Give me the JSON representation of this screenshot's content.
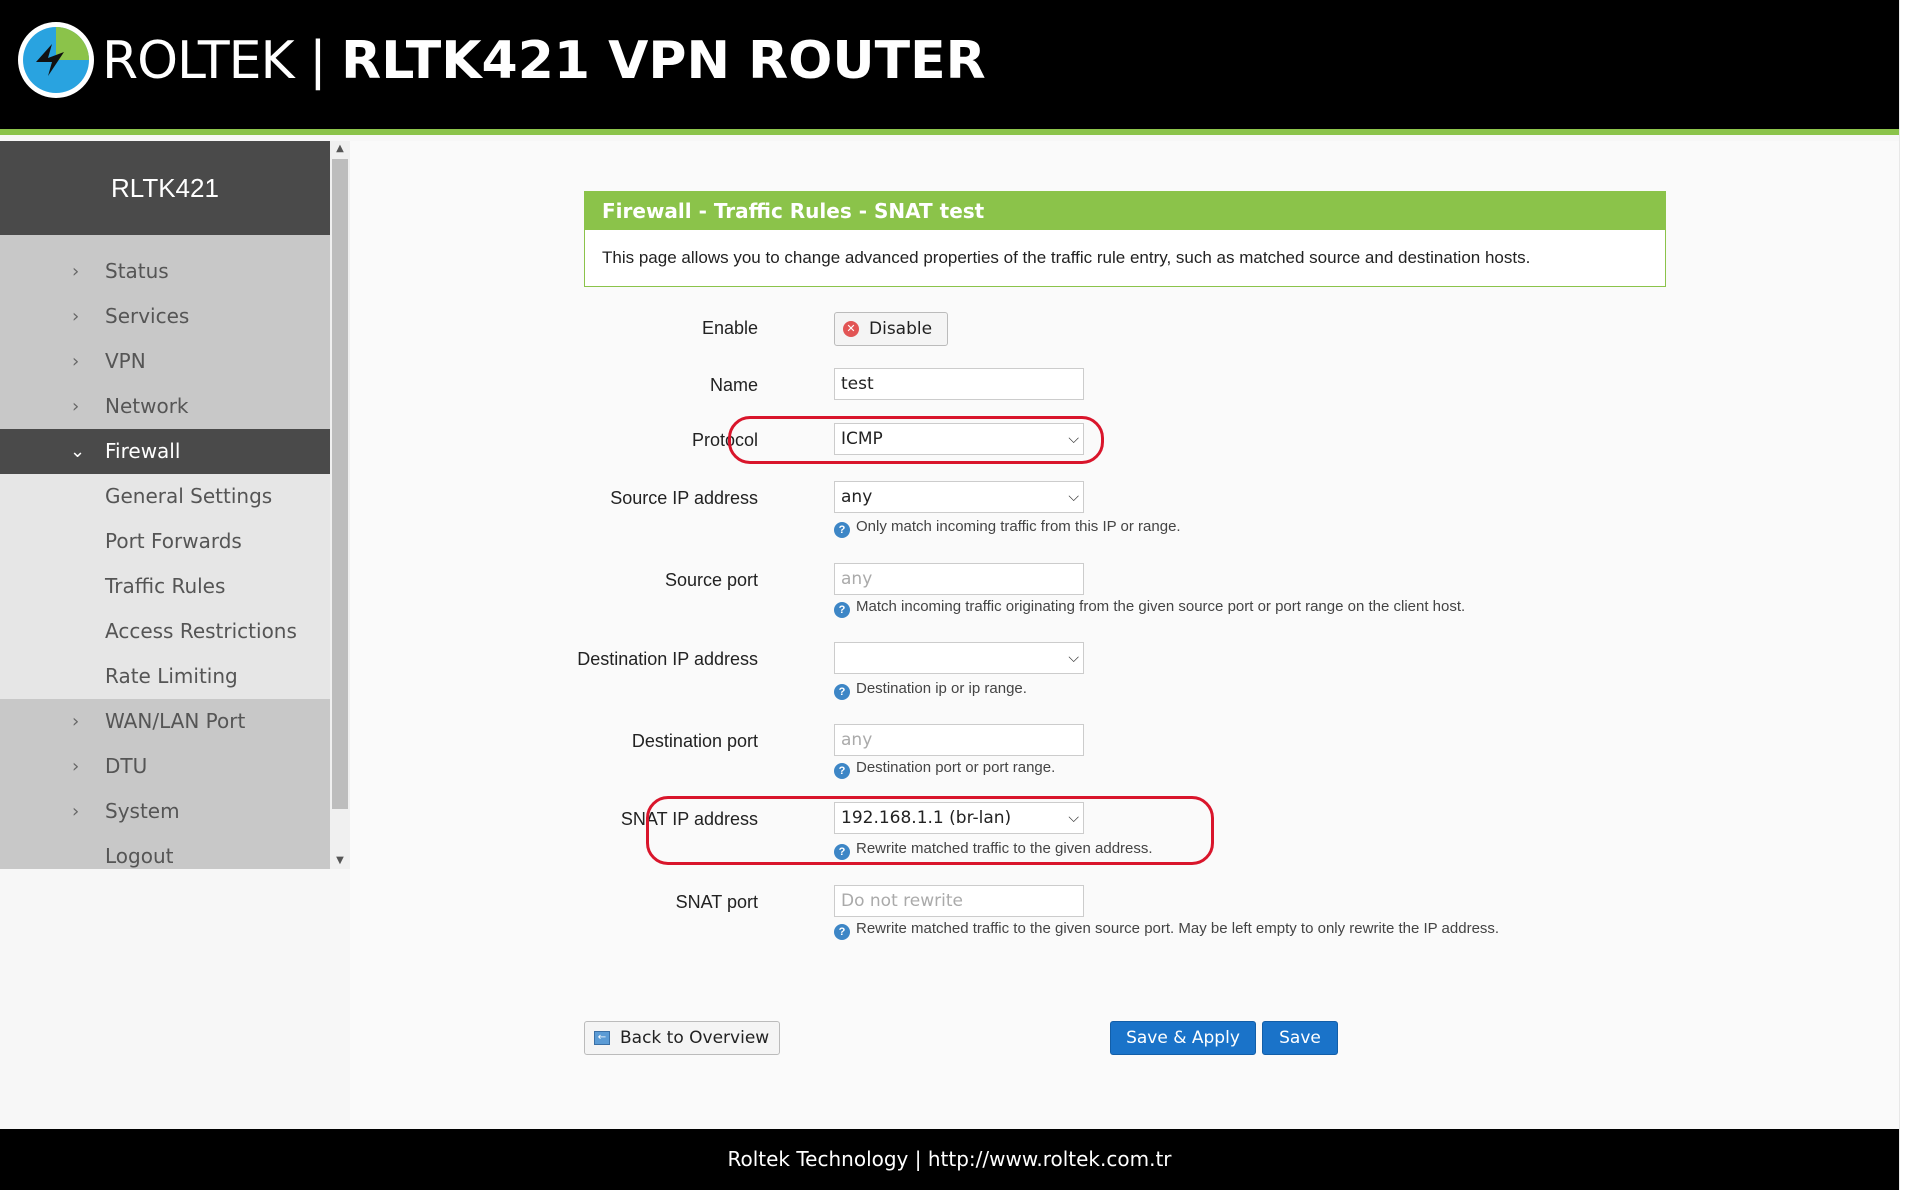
{
  "header": {
    "brand": "ROLTEK | ",
    "model": "RLTK421 VPN ROUTER"
  },
  "sidebar": {
    "title": "RLTK421",
    "items": [
      {
        "label": "Status",
        "state": "collapsed"
      },
      {
        "label": "Services",
        "state": "collapsed"
      },
      {
        "label": "VPN",
        "state": "collapsed"
      },
      {
        "label": "Network",
        "state": "collapsed"
      },
      {
        "label": "Firewall",
        "state": "expanded"
      },
      {
        "label": "General Settings",
        "state": "sub"
      },
      {
        "label": "Port Forwards",
        "state": "sub"
      },
      {
        "label": "Traffic Rules",
        "state": "sub"
      },
      {
        "label": "Access Restrictions",
        "state": "sub"
      },
      {
        "label": "Rate Limiting",
        "state": "sub"
      },
      {
        "label": "WAN/LAN Port",
        "state": "collapsed"
      },
      {
        "label": "DTU",
        "state": "collapsed"
      },
      {
        "label": "System",
        "state": "collapsed"
      },
      {
        "label": "Logout",
        "state": "collapsed"
      }
    ]
  },
  "section": {
    "title": "Firewall - Traffic Rules - SNAT test",
    "description": "This page allows you to change advanced properties of the traffic rule entry, such as matched source and destination hosts."
  },
  "form": {
    "enable": {
      "label": "Enable",
      "button": "Disable"
    },
    "name": {
      "label": "Name",
      "value": "test"
    },
    "protocol": {
      "label": "Protocol",
      "value": "ICMP"
    },
    "source_ip": {
      "label": "Source IP address",
      "value": "any",
      "hint": "Only match incoming traffic from this IP or range."
    },
    "source_port": {
      "label": "Source port",
      "placeholder": "any",
      "hint": "Match incoming traffic originating from the given source port or port range on the client host."
    },
    "dest_ip": {
      "label": "Destination IP address",
      "value": "",
      "hint": "Destination ip or ip range."
    },
    "dest_port": {
      "label": "Destination port",
      "placeholder": "any",
      "hint": "Destination port or port range."
    },
    "snat_ip": {
      "label": "SNAT IP address",
      "value": "192.168.1.1 (br-lan)",
      "hint": "Rewrite matched traffic to the given address."
    },
    "snat_port": {
      "label": "SNAT port",
      "placeholder": "Do not rewrite",
      "hint": "Rewrite matched traffic to the given source port. May be left empty to only rewrite the IP address."
    }
  },
  "actions": {
    "back": "Back to Overview",
    "save_apply": "Save & Apply",
    "save": "Save"
  },
  "footer": {
    "text": "Roltek Technology | http://www.roltek.com.tr"
  },
  "colors": {
    "accent_green": "#8bc34a",
    "primary_blue": "#1a73c9",
    "highlight_red": "#d9152b"
  }
}
